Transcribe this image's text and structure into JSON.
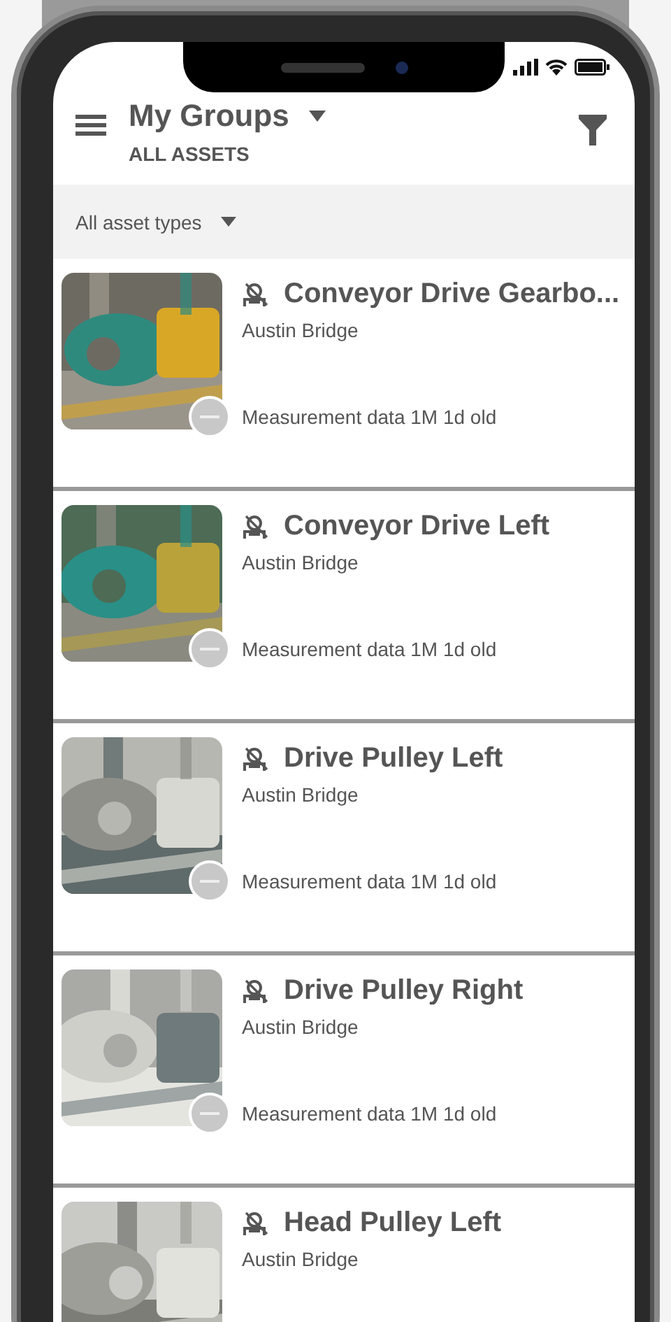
{
  "header": {
    "title": "My Groups",
    "subtitle": "ALL ASSETS"
  },
  "filter": {
    "label": "All asset types"
  },
  "assets": [
    {
      "name": "Conveyor Drive Gearbo...",
      "location": "Austin Bridge",
      "status": "Measurement data 1M 1d old"
    },
    {
      "name": "Conveyor Drive Left",
      "location": "Austin Bridge",
      "status": "Measurement data 1M 1d old"
    },
    {
      "name": "Drive Pulley Left",
      "location": "Austin Bridge",
      "status": "Measurement data 1M 1d old"
    },
    {
      "name": "Drive Pulley Right",
      "location": "Austin Bridge",
      "status": "Measurement data 1M 1d old"
    },
    {
      "name": "Head Pulley Left",
      "location": "Austin Bridge"
    }
  ]
}
